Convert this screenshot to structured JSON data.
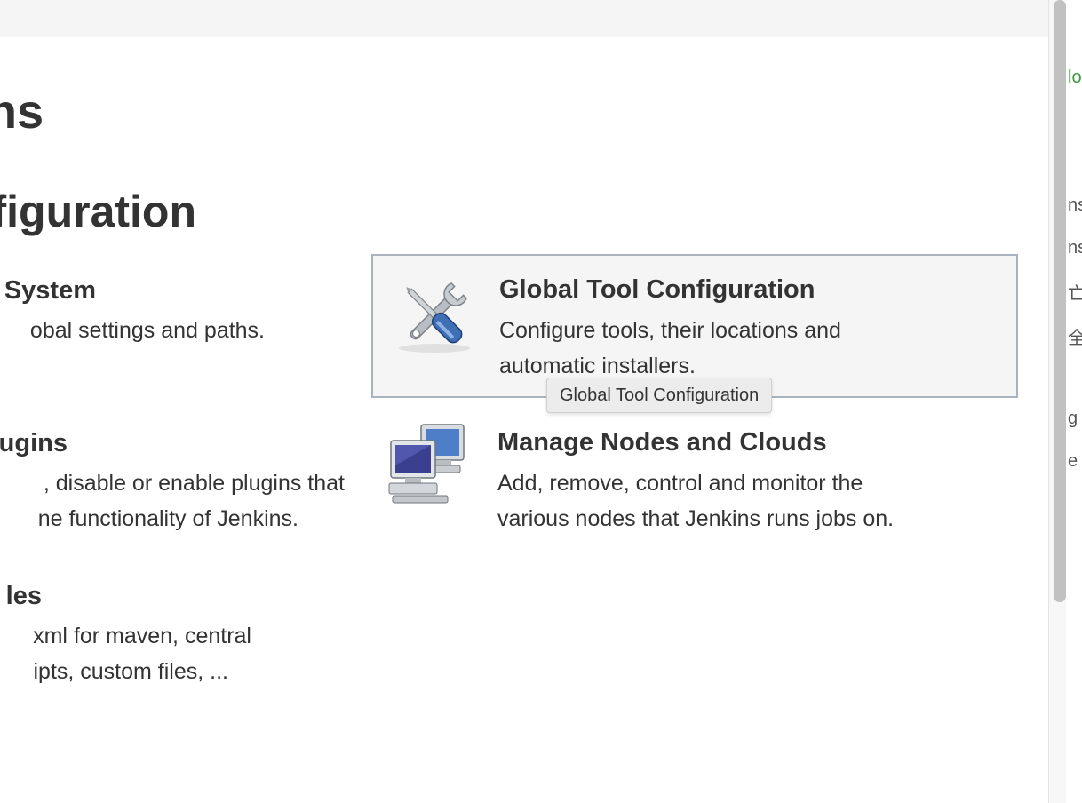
{
  "page": {
    "title_fragment": "ns",
    "section_title_fragment": "nfiguration"
  },
  "items_left": [
    {
      "title": "System",
      "desc_lines": [
        "obal settings and paths."
      ]
    },
    {
      "title": "ugins",
      "desc_lines": [
        ", disable or enable plugins that",
        "ne functionality of Jenkins."
      ]
    },
    {
      "title": "les",
      "desc_lines": [
        "xml for maven, central",
        "ipts, custom files, ..."
      ]
    }
  ],
  "tiles": {
    "global_tool": {
      "title": "Global Tool Configuration",
      "desc_lines": [
        "Configure tools, their locations and",
        "automatic installers."
      ],
      "icon": "wrench-screwdriver-icon"
    },
    "nodes": {
      "title": "Manage Nodes and Clouds",
      "desc_lines": [
        "Add, remove, control and monitor the",
        "various nodes that Jenkins runs jobs on."
      ],
      "icon": "computers-icon"
    }
  },
  "tooltip": {
    "text": "Global Tool Configuration"
  },
  "side_panel": {
    "glyphs": [
      "lo",
      "ns",
      "ns",
      "亡",
      "全",
      "g",
      "e"
    ]
  },
  "colors": {
    "tile_border": "#a8b3bd",
    "tile_bg": "#f5f5f5",
    "link_green": "#3c9a3c"
  }
}
